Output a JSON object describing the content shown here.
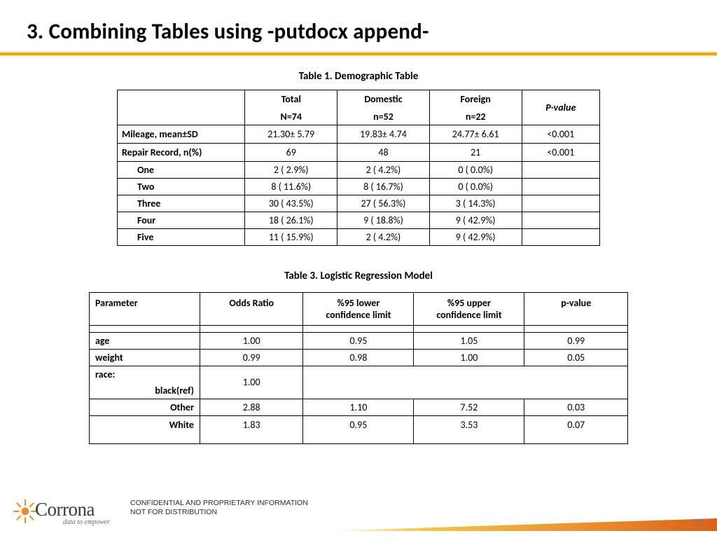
{
  "title": "3. Combining Tables using -putdocx append-",
  "table1": {
    "caption": "Table 1. Demographic Table",
    "cols": {
      "blank": "",
      "total_top": "Total",
      "total_sub": "N=74",
      "dom_top": "Domestic",
      "dom_sub": "n=52",
      "for_top": "Foreign",
      "for_sub": "n=22",
      "pval": "P-value"
    },
    "rows": {
      "mileage": {
        "label": "Mileage, mean±SD",
        "total": "21.30± 5.79",
        "dom": "19.83± 4.74",
        "for": "24.77± 6.61",
        "p": "<0.001"
      },
      "repair": {
        "label": "Repair Record, n(%)",
        "total": "69",
        "dom": "48",
        "for": "21",
        "p": "<0.001"
      },
      "one": {
        "label": "One",
        "total": "2 (  2.9%)",
        "dom": "2 (  4.2%)",
        "for": "0 (  0.0%)",
        "p": ""
      },
      "two": {
        "label": "Two",
        "total": "8 ( 11.6%)",
        "dom": "8 ( 16.7%)",
        "for": "0 (  0.0%)",
        "p": ""
      },
      "three": {
        "label": "Three",
        "total": "30 ( 43.5%)",
        "dom": "27 ( 56.3%)",
        "for": "3 ( 14.3%)",
        "p": ""
      },
      "four": {
        "label": "Four",
        "total": "18 ( 26.1%)",
        "dom": "9 ( 18.8%)",
        "for": "9 ( 42.9%)",
        "p": ""
      },
      "five": {
        "label": "Five",
        "total": "11 ( 15.9%)",
        "dom": "2 (  4.2%)",
        "for": "9 ( 42.9%)",
        "p": ""
      }
    }
  },
  "table3": {
    "caption": "Table 3. Logistic Regression Model",
    "cols": {
      "param": "Parameter",
      "or": "Odds Ratio",
      "lo_top": "%95 lower",
      "lo_sub": "confidence limit",
      "hi_top": "%95 upper",
      "hi_sub": "confidence limit",
      "pval": "p-value"
    },
    "rows": {
      "age": {
        "label": "age",
        "or": "1.00",
        "lo": "0.95",
        "hi": "1.05",
        "p": "0.99"
      },
      "weight": {
        "label": "weight",
        "or": "0.99",
        "lo": "0.98",
        "hi": "1.00",
        "p": "0.05"
      },
      "race_top": {
        "label": "race:"
      },
      "race_ref": {
        "label": "black(ref)",
        "or": "1.00"
      },
      "other": {
        "label": "Other",
        "or": "2.88",
        "lo": "1.10",
        "hi": "7.52",
        "p": "0.03"
      },
      "white": {
        "label": "White",
        "or": "1.83",
        "lo": "0.95",
        "hi": "3.53",
        "p": "0.07"
      }
    }
  },
  "footer": {
    "conf1": "CONFIDENTIAL AND PROPRIETARY INFORMATION",
    "conf2": "NOT FOR DISTRIBUTION",
    "page": "13",
    "brand": "Corrona",
    "tagline": "data to empower"
  }
}
